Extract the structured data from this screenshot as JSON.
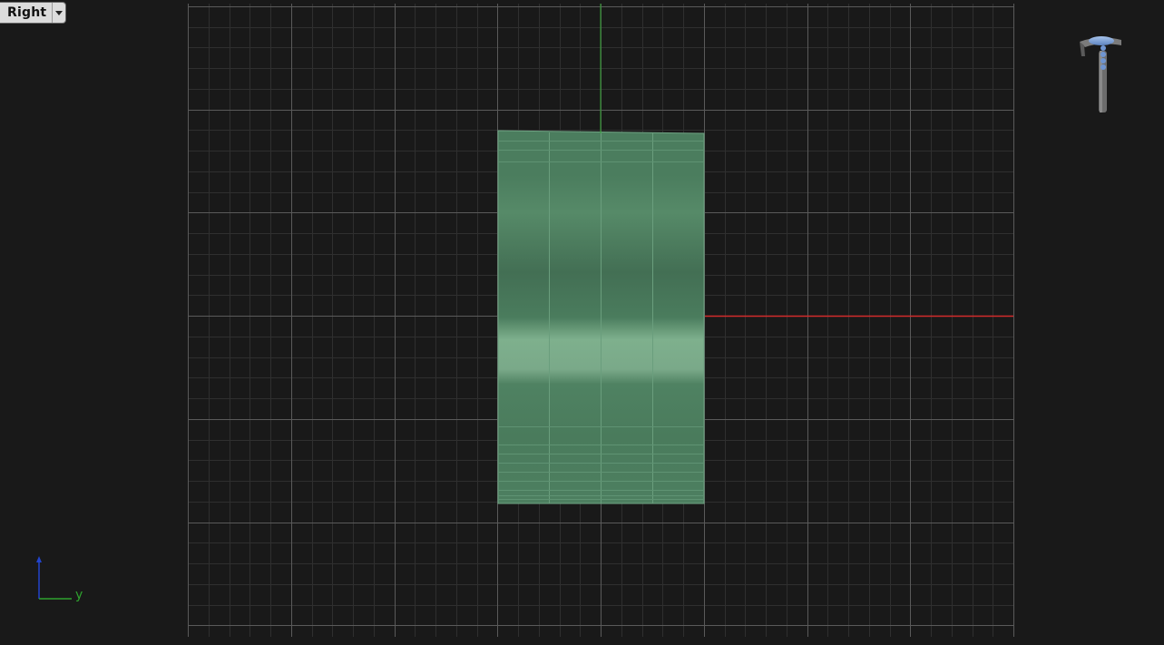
{
  "viewport": {
    "view_name": "Right",
    "view_menu_icon": "chevron-down-icon",
    "background_color": "#191919",
    "grid_minor_color": "#2f2f2f",
    "grid_major_color": "#5a5a5a",
    "axis_x_color": "#d22b2b",
    "axis_y_color": "#2fa32f",
    "mesh_color": "#4f8a66",
    "corner_axis": {
      "vertical_color": "#2244cc",
      "horizontal_color": "#2fa32f",
      "horizontal_label": "y"
    },
    "navigation_widget_icon": "view-navigation-gizmo-icon"
  }
}
